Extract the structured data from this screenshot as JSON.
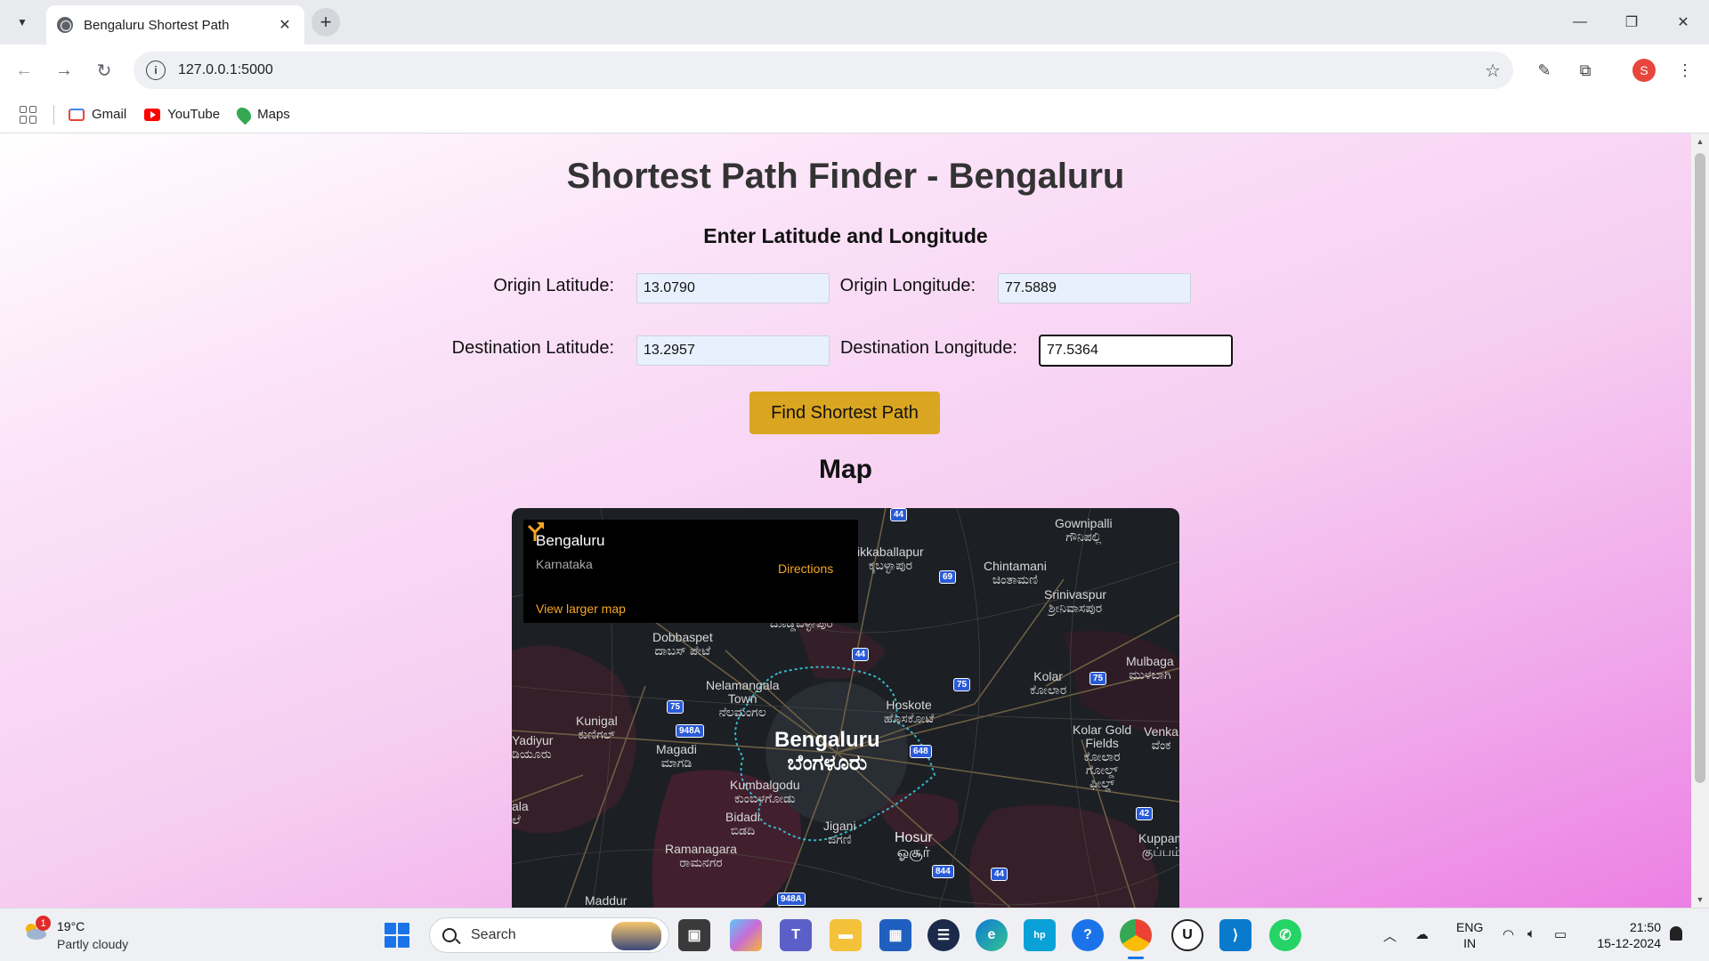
{
  "browser": {
    "tab_title": "Bengaluru Shortest Path",
    "url": "127.0.0.1:5000",
    "profile_initial": "S",
    "bookmarks": [
      {
        "label": "Gmail",
        "icon": "gmail-icon"
      },
      {
        "label": "YouTube",
        "icon": "youtube-icon"
      },
      {
        "label": "Maps",
        "icon": "maps-icon"
      }
    ]
  },
  "page": {
    "title": "Shortest Path Finder - Bengaluru",
    "subtitle": "Enter Latitude and Longitude",
    "origin_lat_label": "Origin Latitude:",
    "origin_lat_value": "13.0790",
    "origin_lng_label": "Origin Longitude:",
    "origin_lng_value": "77.5889",
    "dest_lat_label": "Destination Latitude:",
    "dest_lat_value": "13.2957",
    "dest_lng_label": "Destination Longitude:",
    "dest_lng_value": "77.5364",
    "button_label": "Find Shortest Path",
    "map_heading": "Map",
    "button_color": "#daa520"
  },
  "map": {
    "card_name": "Bengaluru",
    "card_region": "Karnataka",
    "card_link": "View larger map",
    "card_directions": "Directions",
    "labels": {
      "gownipalli": "Gownipalli\nಗೌನಿಪಲ್ಲಿ",
      "chikkaballapur": "ikkaballapur\nಕ್ಕಬಳ್ಳಾಪುರ",
      "chintamani": "Chintamani\nಚಿಂತಾಮಣಿ",
      "srinivaspur": "Srinivaspur\nಶ್ರೀನಿವಾಸಪುರ",
      "doddaballapur": "ದೊಡ್ಡಬಳ್ಳಾಪುರ",
      "dobbaspet": "Dobbaspet\nದಾಬಸ್ ಪೇಟೆ",
      "mulbagal": "Mulbaga\nಮುಳಬಾಗಿ",
      "kolar": "Kolar\nಕೋಲಾರ",
      "nelamangala": "Nelamangala\nTown\nನೆಲಮಂಗಲ",
      "hoskote": "Hoskote\nಹೊಸಕೋಟೆ",
      "kunigal": "Kunigal\nಕುಣಿಗಲ್",
      "kolar_gold_fields": "Kolar Gold\nFields\nಕೋಲಾರ\nಗೋಲ್ಡ್\nಫೀಲ್ಡ್",
      "venkata": "Venka\nವೆಂಕ",
      "yadiyur": "Yadiyur\nಡಿಯೂರು",
      "magadi": "Magadi\nಮಾಗಡಿ",
      "bengaluru": "Bengaluru\nಬೆಂಗಳೂರು",
      "kumbalgodu": "Kumbalgodu\nಕುಂಬಳಗೋಡು",
      "bidadi": "Bidadi\nಬಿಡದಿ",
      "jigani": "Jigani\nಜಿಗಣಿ",
      "hosur": "Hosur\nஓசூர்",
      "kuppam": "Kuppam\nகுப்பம்",
      "ramanagara": "Ramanagara\nರಾಮನಗರ",
      "kala": "ala\nಲೆ",
      "maddur": "Maddur"
    },
    "shields": [
      "44",
      "69",
      "44",
      "75",
      "75",
      "75",
      "948A",
      "648",
      "42",
      "844",
      "44",
      "948A"
    ]
  },
  "taskbar": {
    "weather_temp": "19°C",
    "weather_desc": "Partly cloudy",
    "weather_badge": "1",
    "search_placeholder": "Search",
    "lang_line1": "ENG",
    "lang_line2": "IN",
    "time": "21:50",
    "date": "15-12-2024"
  }
}
